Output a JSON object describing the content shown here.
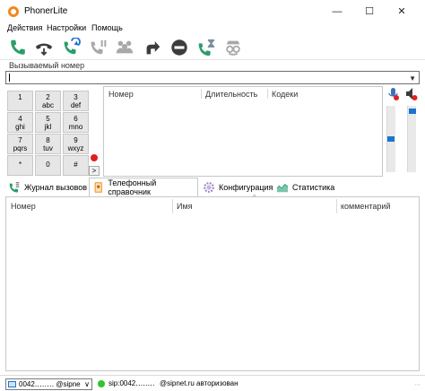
{
  "window": {
    "title": "PhonerLite"
  },
  "menu": [
    "Действия",
    "Настройки",
    "Помощь"
  ],
  "toolbar": {
    "buttons": [
      "call-icon",
      "hangup-icon",
      "redial-icon",
      "hold-icon",
      "conference-icon",
      "transfer-icon",
      "dnd-icon",
      "call-waiting-icon",
      "anonymous-icon"
    ]
  },
  "number": {
    "label": "Вызываемый номер",
    "value": ""
  },
  "dialpad": [
    {
      "main": "1",
      "sub": ""
    },
    {
      "main": "2",
      "sub": "abc"
    },
    {
      "main": "3",
      "sub": "def"
    },
    {
      "main": "4",
      "sub": "ghi"
    },
    {
      "main": "5",
      "sub": "jkl"
    },
    {
      "main": "6",
      "sub": "mno"
    },
    {
      "main": "7",
      "sub": "pqrs"
    },
    {
      "main": "8",
      "sub": "tuv"
    },
    {
      "main": "9",
      "sub": "wxyz"
    },
    {
      "main": "*",
      "sub": ""
    },
    {
      "main": "0",
      "sub": ""
    },
    {
      "main": "#",
      "sub": ""
    }
  ],
  "side_button": ">",
  "calls": {
    "columns": [
      "Номер",
      "Длительность",
      "Кодеки"
    ]
  },
  "volume": {
    "mic_level": 0.5,
    "speaker_level": 0.96
  },
  "tabs": {
    "history": "Журнал вызовов",
    "phonebook": "Телефонный справочник",
    "config": "Конфигурация",
    "stats": "Статистика"
  },
  "phonebook": {
    "columns": [
      "Номер",
      "Имя",
      "комментарий"
    ]
  },
  "status": {
    "account_combo": "0042‥‥‥‥ @sipne",
    "sip_account": "sip:0042‥‥‥‥",
    "state": "@sipnet.ru авторизован"
  },
  "colors": {
    "accent_green": "#2a9d6a",
    "gray_icon": "#a8a8a8",
    "dark_icon": "#3c3c3c",
    "record_red": "#e02020",
    "slider_blue": "#1b74d0",
    "status_green": "#2ec52e"
  }
}
